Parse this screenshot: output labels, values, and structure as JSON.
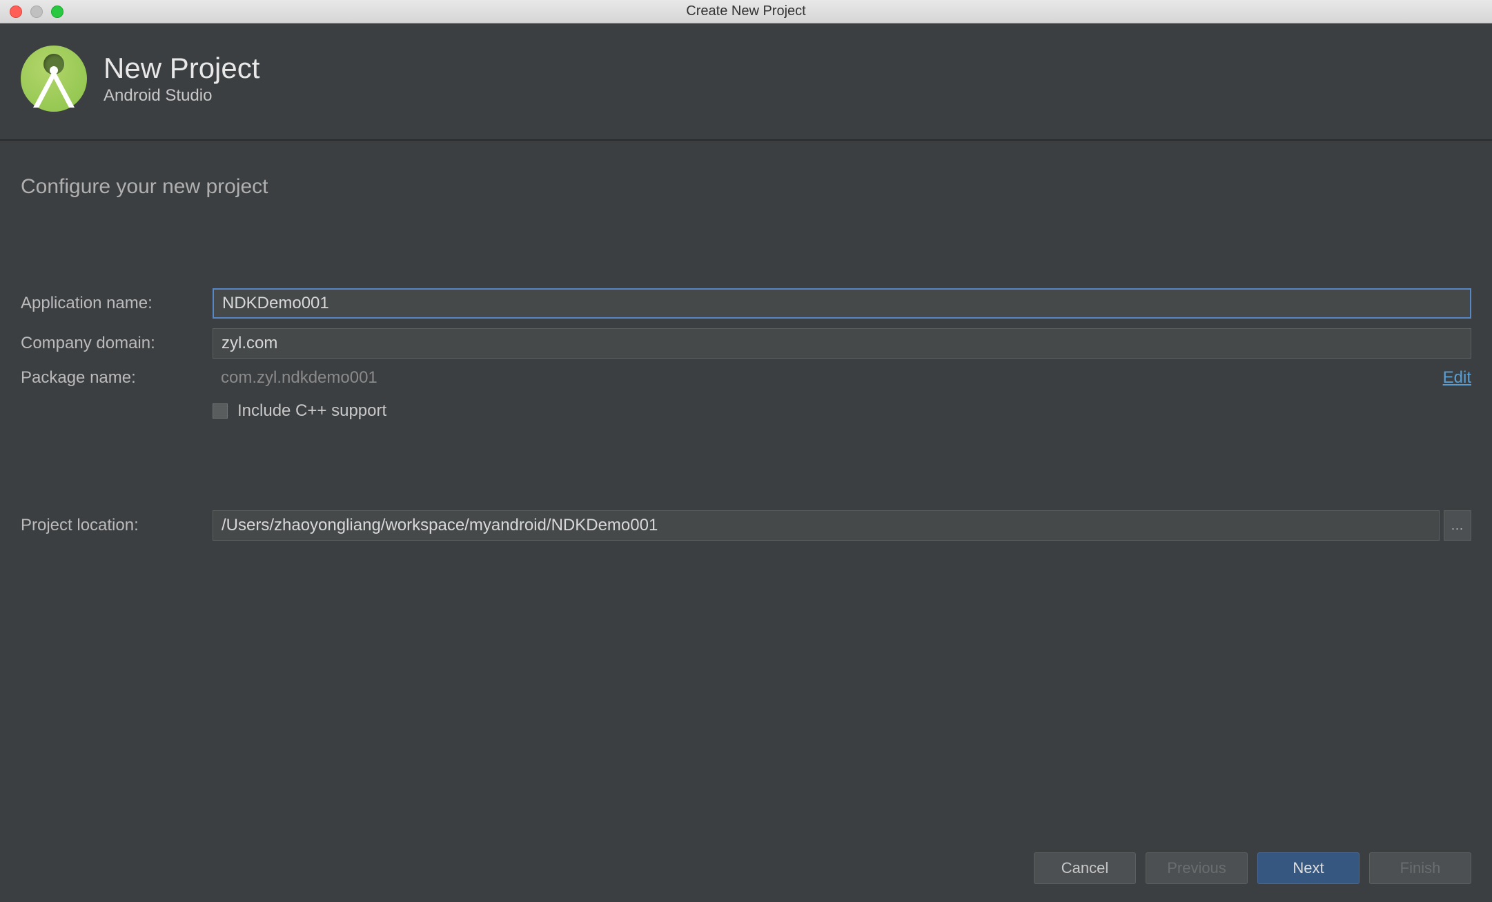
{
  "window": {
    "title": "Create New Project"
  },
  "header": {
    "title": "New Project",
    "subtitle": "Android Studio"
  },
  "section": {
    "title": "Configure your new project"
  },
  "form": {
    "application_name_label": "Application name:",
    "application_name_value": "NDKDemo001",
    "company_domain_label": "Company domain:",
    "company_domain_value": "zyl.com",
    "package_name_label": "Package name:",
    "package_name_value": "com.zyl.ndkdemo001",
    "edit_link": "Edit",
    "cpp_checkbox_label": "Include C++ support",
    "cpp_checkbox_checked": false,
    "project_location_label": "Project location:",
    "project_location_value": "/Users/zhaoyongliang/workspace/myandroid/NDKDemo001",
    "browse_label": "..."
  },
  "buttons": {
    "cancel": "Cancel",
    "previous": "Previous",
    "next": "Next",
    "finish": "Finish"
  }
}
